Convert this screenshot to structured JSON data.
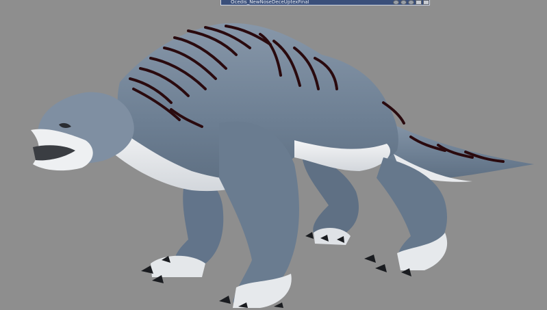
{
  "window": {
    "title": "Ocedis_NewNoseDeceUptexFinal",
    "buttons": [
      "rewind-icon",
      "stop-icon",
      "record-icon",
      "minimize-icon",
      "close-icon"
    ]
  },
  "scene": {
    "subject": "creature-3d-model",
    "background_color": "#8e8e8e",
    "body_color": "#6e8094",
    "belly_color": "#eef0f2",
    "stripe_color": "#2a0a0e",
    "claw_color": "#1a1c20"
  }
}
